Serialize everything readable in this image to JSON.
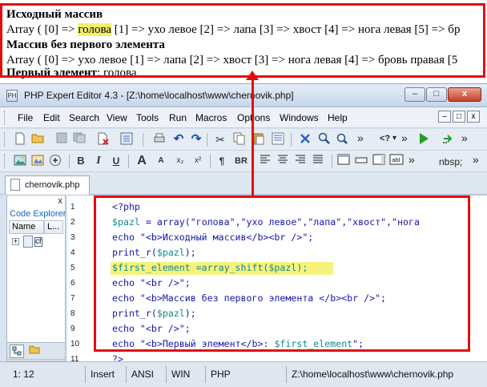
{
  "output": {
    "heading1": "Исходный массив",
    "array1_prefix": "Array ( [0] => ",
    "array1_highlight": "голова",
    "array1_rest": " [1] => ухо левое [2] => лапа [3] => хвост [4] => нога левая [5] => бр",
    "heading2": "Массив без первого элемента",
    "array2": "Array ( [0] => ухо левое [1] => лапа [2] => хвост [3] => нога левая [4] => бровь правая [5",
    "first_label": "Первый элемент",
    "first_value": ": голова"
  },
  "window": {
    "title": "PHP Expert Editor 4.3 - [Z:\\home\\localhost\\www\\chernovik.php]",
    "app_icon": "PH",
    "minimize": "–",
    "maximize": "□",
    "close": "x"
  },
  "menu": {
    "items": [
      "File",
      "Edit",
      "Search",
      "View",
      "Tools",
      "Run",
      "Macros",
      "Options",
      "Windows",
      "Help"
    ],
    "minimize": "–",
    "restore": "□",
    "close": "x"
  },
  "toolbar1": {
    "overflow": "»",
    "overflow2": "»",
    "overflow3": "»",
    "tag_button": "<?",
    "dropdown": "▾"
  },
  "toolbar2": {
    "bold": "B",
    "italic": "I",
    "underline": "U",
    "font_big": "A",
    "font_small": "A",
    "subscript": "x₂",
    "superscript": "x²",
    "paragraph": "¶",
    "br": "BR",
    "nbsp": "nbsp;",
    "overflow": "»",
    "overflow2": "»"
  },
  "tab": {
    "label": "chernovik.php"
  },
  "explorer": {
    "close": "x",
    "title": "Code Explorer",
    "col_name": "Name",
    "col_line": "L...",
    "expand": "+",
    "tree_label": "ch"
  },
  "code": {
    "line_numbers": [
      "1",
      "2",
      "3",
      "4",
      "5",
      "6",
      "7",
      "8",
      "9",
      "10",
      "11"
    ],
    "l1": "<?php",
    "l2_var": "$pazl",
    "l2_eq": " = ",
    "l2_fn": "array",
    "l2_args": "(\"голова\",\"ухо левое\",\"лапа\",\"хвост\",\"нога",
    "l3_kw": "echo",
    "l3_str": " \"<b>Исходный массив</b><br />\";",
    "l4_fn": "print_r",
    "l4_open": "(",
    "l4_var": "$pazl",
    "l4_close": ");",
    "l5": "$first_element =array_shift($pazl);",
    "l6_kw": "echo",
    "l6_str": " \"<br />\";",
    "l7_kw": "echo",
    "l7_str": " \"<b>Массив без первого элемента </b><br />\";",
    "l8_fn": "print_r",
    "l8_open": "(",
    "l8_var": "$pazl",
    "l8_close": ");",
    "l9_kw": "echo",
    "l9_str": " \"<br />\";",
    "l10_kw": "echo",
    "l10_str": " \"<b>Первый элемент</b>: ",
    "l10_var": "$first_element",
    "l10_end": "\";",
    "l11": "?>"
  },
  "status": {
    "position": "1: 12",
    "mode": "Insert",
    "encoding": "ANSI",
    "line_ending": "WIN",
    "language": "PHP",
    "path": "Z:\\home\\localhost\\www\\chernovik.php"
  },
  "colors": {
    "annotation_red": "#e01010",
    "highlight_yellow": "#f3f06a",
    "code_blue": "#1616b0",
    "code_teal": "#118a8a"
  }
}
